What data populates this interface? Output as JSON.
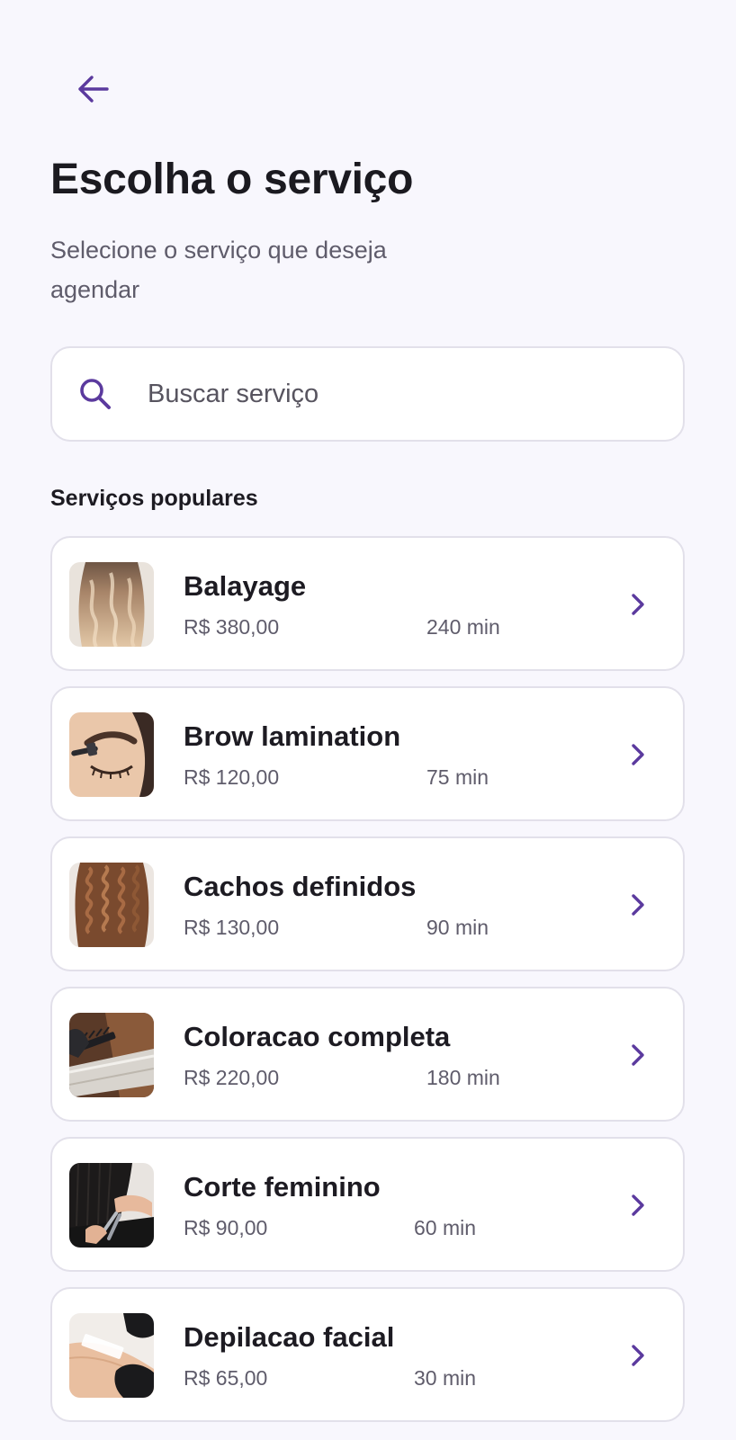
{
  "header": {
    "title": "Escolha o serviço",
    "subtitle": "Selecione o serviço que deseja agendar"
  },
  "search": {
    "placeholder": "Buscar serviço",
    "value": ""
  },
  "section": {
    "title": "Serviços populares"
  },
  "services": [
    {
      "name": "Balayage",
      "price": "R$ 380,00",
      "duration": "240 min",
      "image": "wavy-balayage-hair-photo"
    },
    {
      "name": "Brow lamination",
      "price": "R$ 120,00",
      "duration": "75 min",
      "image": "brow-brush-closed-eye-photo"
    },
    {
      "name": "Cachos definidos",
      "price": "R$ 130,00",
      "duration": "90 min",
      "image": "curly-brown-hair-photo"
    },
    {
      "name": "Coloracao completa",
      "price": "R$ 220,00",
      "duration": "180 min",
      "image": "hair-coloring-foil-photo"
    },
    {
      "name": "Corte feminino",
      "price": "R$ 90,00",
      "duration": "60 min",
      "image": "haircut-scissors-photo"
    },
    {
      "name": "Depilacao facial",
      "price": "R$ 65,00",
      "duration": "30 min",
      "image": "wax-strip-gloved-hand-photo"
    }
  ],
  "icons": {
    "back": "arrow-left-icon",
    "search": "search-icon",
    "row_action": "chevron-right-icon"
  },
  "colors": {
    "accent": "#5B3A9E",
    "background": "#F8F7FD",
    "card": "#FFFFFF",
    "border": "#E2E0EA",
    "text_primary": "#1D1B22",
    "text_secondary": "#5F5C6B"
  }
}
